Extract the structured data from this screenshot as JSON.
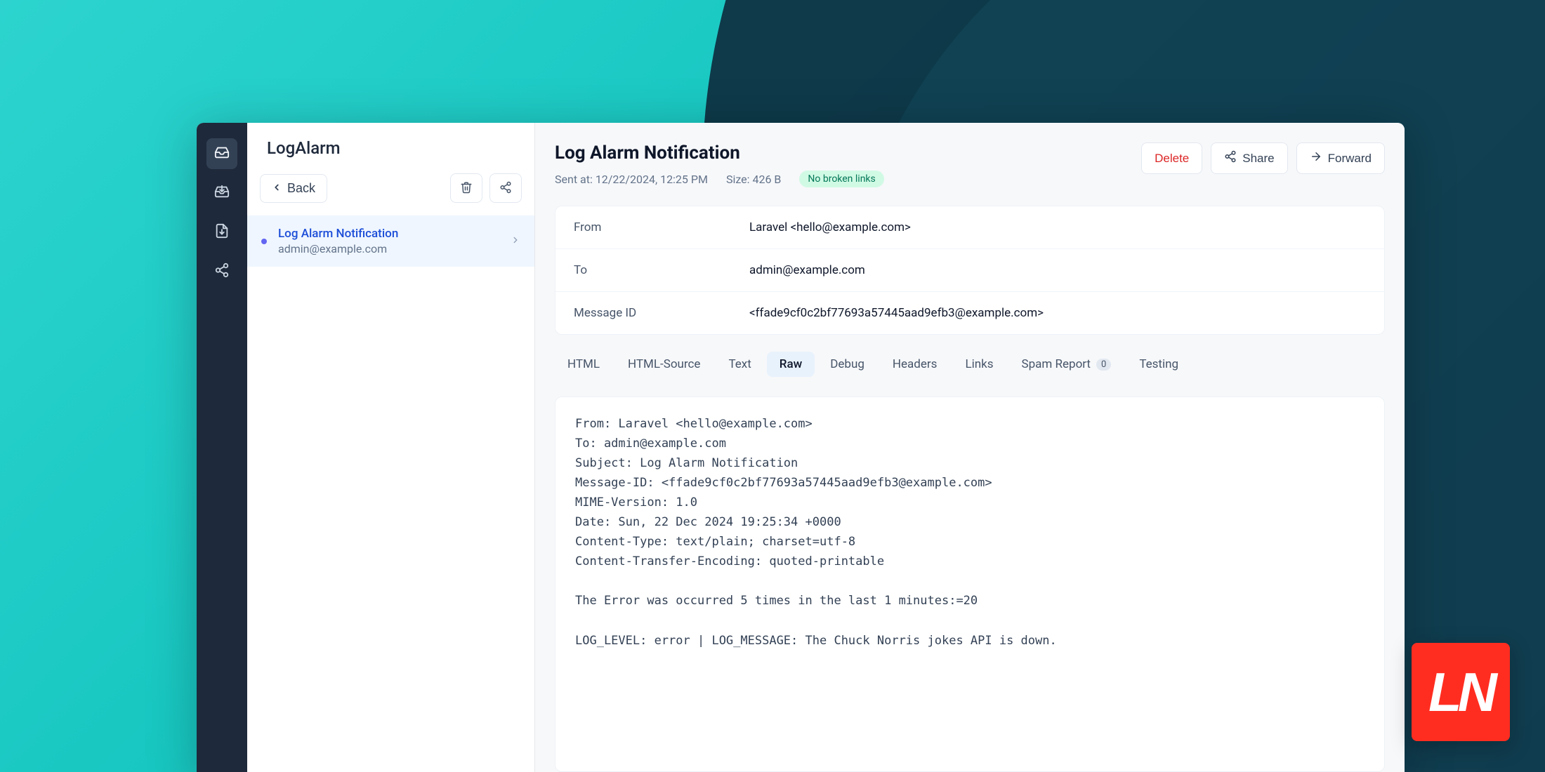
{
  "sidebar": {
    "title": "LogAlarm",
    "back_label": "Back"
  },
  "message_item": {
    "title": "Log Alarm Notification",
    "recipient": "admin@example.com"
  },
  "header": {
    "title": "Log Alarm Notification",
    "sent_at_label": "Sent at:",
    "sent_at_value": "12/22/2024, 12:25 PM",
    "size_label": "Size:",
    "size_value": "426 B",
    "links_badge": "No broken links"
  },
  "actions": {
    "delete": "Delete",
    "share": "Share",
    "forward": "Forward"
  },
  "meta": {
    "from_label": "From",
    "from_value": "Laravel <hello@example.com>",
    "to_label": "To",
    "to_value": "admin@example.com",
    "msgid_label": "Message ID",
    "msgid_value": "<ffade9cf0c2bf77693a57445aad9efb3@example.com>"
  },
  "tabs": {
    "html": "HTML",
    "html_source": "HTML-Source",
    "text": "Text",
    "raw": "Raw",
    "debug": "Debug",
    "headers": "Headers",
    "links": "Links",
    "spam": "Spam Report",
    "spam_count": "0",
    "testing": "Testing"
  },
  "raw_body": "From: Laravel <hello@example.com>\nTo: admin@example.com\nSubject: Log Alarm Notification\nMessage-ID: <ffade9cf0c2bf77693a57445aad9efb3@example.com>\nMIME-Version: 1.0\nDate: Sun, 22 Dec 2024 19:25:34 +0000\nContent-Type: text/plain; charset=utf-8\nContent-Transfer-Encoding: quoted-printable\n\nThe Error was occurred 5 times in the last 1 minutes:=20\n\nLOG_LEVEL: error | LOG_MESSAGE: The Chuck Norris jokes API is down.",
  "logo_text": "LN"
}
